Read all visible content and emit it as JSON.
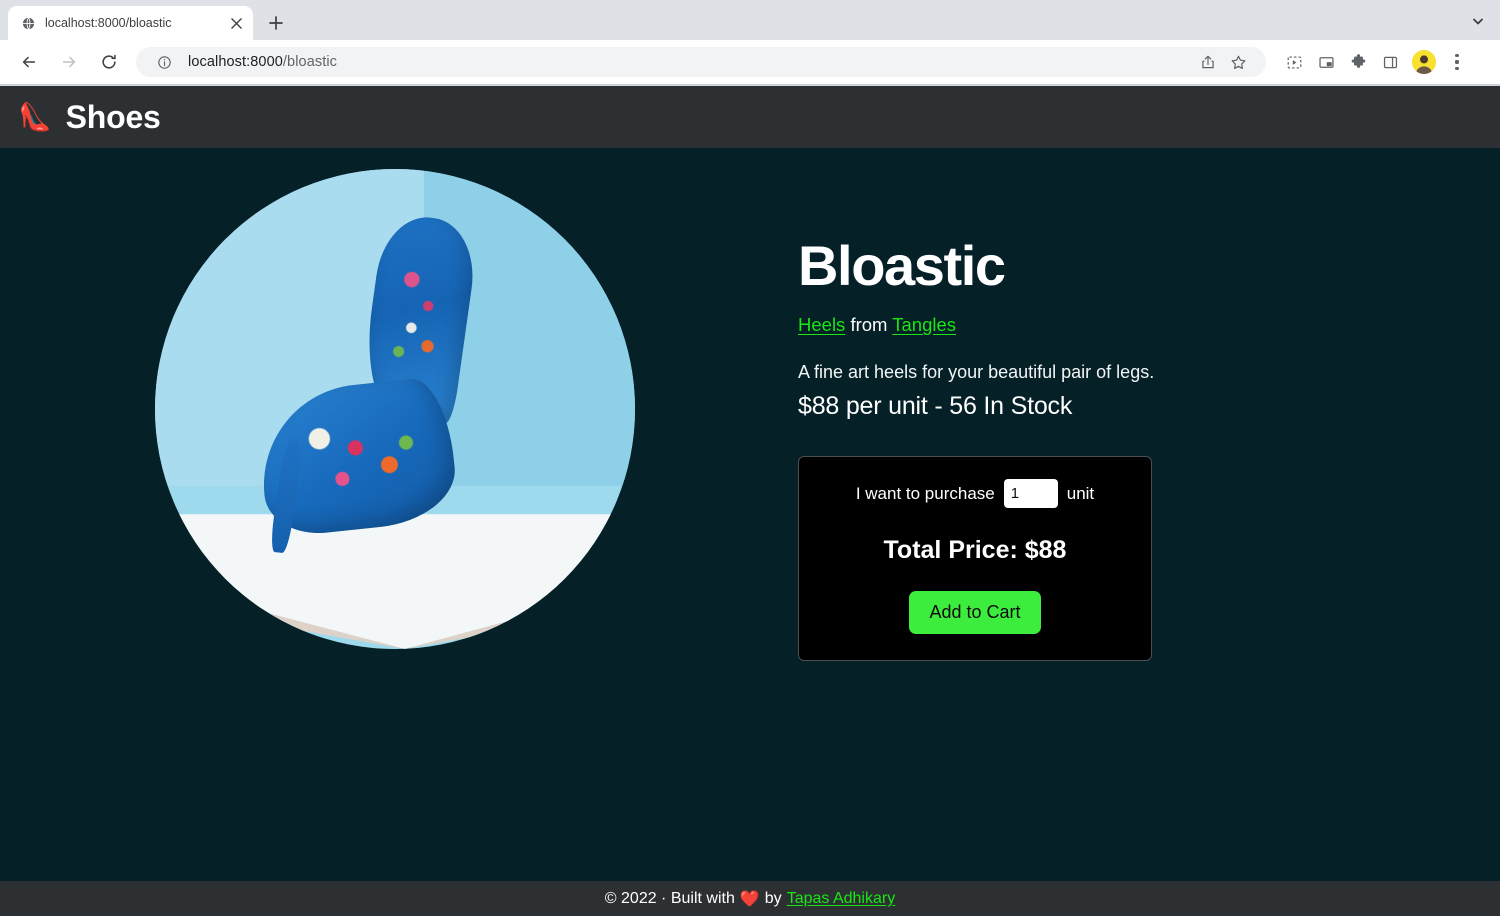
{
  "browser": {
    "tab": {
      "title": "localhost:8000/bloastic",
      "favicon_icon": "globe-icon",
      "close_icon": "close-icon"
    },
    "new_tab_icon": "plus-icon",
    "tab_list_icon": "chevron-down-icon",
    "nav": {
      "back_icon": "arrow-left-icon",
      "forward_icon": "arrow-right-icon",
      "reload_icon": "reload-icon"
    },
    "omnibox": {
      "info_icon": "info-circle-icon",
      "url_host": "localhost:8000",
      "url_path": "/bloastic",
      "share_icon": "share-icon",
      "bookmark_icon": "star-icon"
    },
    "toolbar_icons": {
      "qr_icon": "qr-capture-icon",
      "pip_icon": "picture-in-picture-icon",
      "extensions_icon": "puzzle-icon",
      "side_panel_icon": "side-panel-icon",
      "avatar_icon": "profile-avatar",
      "menu_icon": "three-dots-menu-icon"
    }
  },
  "site": {
    "header": {
      "logo_emoji": "👠",
      "logo_icon": "high-heel-icon",
      "name": "Shoes"
    },
    "product": {
      "image_alt": "blue floral high heel shoes",
      "title": "Bloastic",
      "category": "Heels",
      "from_word": "from",
      "brand": "Tangles",
      "description": "A fine art heels for your beautiful pair of legs.",
      "price_line": "$88 per unit - 56 In Stock",
      "unit_price": 88,
      "stock": 56
    },
    "purchase": {
      "prompt_prefix": "I want to purchase",
      "quantity_value": "1",
      "quantity_placeholder": "1",
      "prompt_suffix": "unit",
      "total_label": "Total Price: $88",
      "add_to_cart_label": "Add to Cart",
      "accent_color": "#3ded3d"
    },
    "footer": {
      "copyright": "© 2022 · Built with",
      "heart": "❤️",
      "by_word": "by",
      "author": "Tapas Adhikary"
    },
    "colors": {
      "page_background": "#052027",
      "bar_background": "#2c3032",
      "link_green": "#18e615",
      "card_background": "#000000"
    }
  }
}
